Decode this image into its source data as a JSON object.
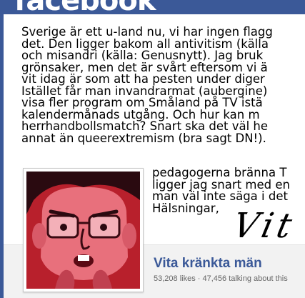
{
  "app": {
    "brand": "facebook"
  },
  "post": {
    "lines": [
      "Sverige är ett u-land nu, vi har ingen flagg",
      "det. Den ligger bakom all antivitism (källa",
      "och misandri (källa: Genusnytt). Jag bruk",
      "grönsaker, men det är svårt eftersom vi ä",
      "vit idag är som att ha pesten under diger",
      "Istället får man invandrarmat (aubergine)",
      "visa fler program om Småland på TV istä",
      "kalendermånads utgång. Och hur kan m",
      "herrhandbollsmatch? Snart ska det väl he",
      "annat än queerextremism (bra sagt DN!)."
    ],
    "continued_lines": [
      "pedagogerna bränna T",
      "ligger jag snart med en",
      "man väl inte säga i det",
      "Hälsningar,"
    ],
    "signature": "Vit k"
  },
  "page": {
    "name": "Vita kränkta män",
    "stats": "53,208 likes · 47,456 talking about this"
  },
  "colors": {
    "brand_blue": "#3b5998",
    "avatar_bg": "#b8202c",
    "avatar_face": "#e8707c"
  }
}
